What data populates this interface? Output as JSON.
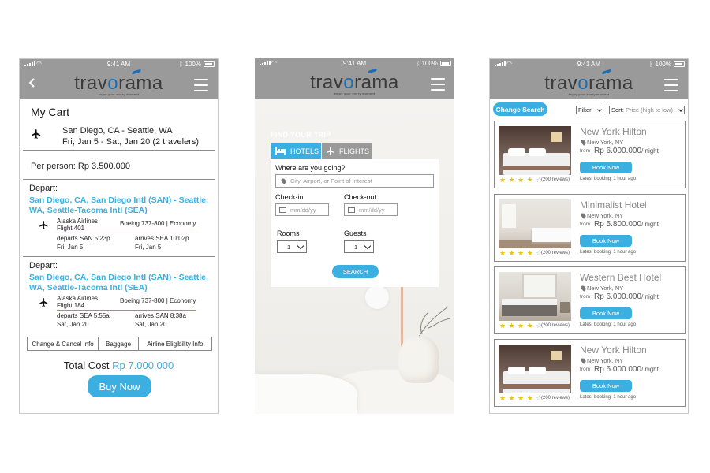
{
  "status": {
    "time": "9:41 AM",
    "battery": "100%"
  },
  "brand": {
    "name_pre": "trav",
    "name_o": "o",
    "name_post": "rama",
    "tagline": "enjoy your every moment"
  },
  "cart": {
    "title": "My Cart",
    "trip_route": "San Diego, CA - Seattle, WA",
    "trip_dates": "Fri, Jan 5 - Sat, Jan 20  (2 travelers)",
    "per_person": "Per person: Rp 3.500.000",
    "flights": [
      {
        "label": "Depart:",
        "route": "San Diego, CA, San Diego Intl (SAN) - Seattle, WA, Seattle-Tacoma Intl (SEA)",
        "airline": "Alaska Airlines",
        "flight": "Flight 401",
        "aircraft": "Boeing 737-800 | Economy",
        "departs": "departs SAN 5:23p",
        "departs_date": "Fri, Jan 5",
        "arrives": "arrives SEA 10:02p",
        "arrives_date": "Fri, Jan 5"
      },
      {
        "label": "Depart:",
        "route": "San Diego, CA, San Diego Intl (SAN) - Seattle, WA, Seattle-Tacoma Intl (SEA)",
        "airline": "Alaska Airlines",
        "flight": "Flight 184",
        "aircraft": "Boeing 737-800 | Economy",
        "departs": "departs SEA 5:55a",
        "departs_date": "Sat, Jan 20",
        "arrives": "arrives SAN 8:38a",
        "arrives_date": "Sat, Jan 20"
      }
    ],
    "tabs": [
      "Change & Cancel Info",
      "Baggage",
      "Airline Eligibility Info"
    ],
    "total_label": "Total Cost",
    "total_amount": "Rp 7.000.000",
    "buy_label": "Buy Now"
  },
  "search": {
    "find_label": "FIND YOUR TRIP",
    "tab_hotels": "HOTELS",
    "tab_flights": "FLIGHTS",
    "where_label": "Where are you going?",
    "where_placeholder": "City, Airport, or Point of Interest",
    "checkin_label": "Check-in",
    "checkout_label": "Check-out",
    "date_placeholder": "mm/dd/yy",
    "rooms_label": "Rooms",
    "rooms_value": "1",
    "guests_label": "Guests",
    "guests_value": "1",
    "search_label": "SEARCH"
  },
  "results": {
    "change_search": "Change Search",
    "filter_label": "Filter:",
    "sort_label": "Sort:",
    "sort_value": "Price (high to low)",
    "hotels": [
      {
        "name": "New York Hilton",
        "location": "New York, NY",
        "from": "from",
        "price": "Rp 6.000.000",
        "per_night": "/ night",
        "book": "Book Now",
        "stars": "★ ★ ★ ★",
        "star_off": "☆",
        "rating": 4,
        "reviews": "(200 reviews)",
        "latest": "Latest booking: 1 hour ago"
      },
      {
        "name": "Minimalist Hotel",
        "location": "New York, NY",
        "from": "from",
        "price": "Rp 5.800.000",
        "per_night": "/ night",
        "book": "Book Now",
        "stars": "★ ★ ★ ★",
        "star_off": "☆",
        "rating": 4,
        "reviews": "(200 reviews)",
        "latest": "Latest booking: 1 hour ago"
      },
      {
        "name": "Western Best Hotel",
        "location": "New York, NY",
        "from": "from",
        "price": "Rp 6.000.000",
        "per_night": "/ night",
        "book": "Book Now",
        "stars": "★ ★ ★ ★",
        "star_off": "☆",
        "rating": 4,
        "reviews": "(200 reviews)",
        "latest": "Latest booking: 1 hour ago"
      },
      {
        "name": "New York Hilton",
        "location": "New York, NY",
        "from": "from",
        "price": "Rp 6.000.000",
        "per_night": "/ night",
        "book": "Book Now",
        "stars": "★ ★ ★ ★",
        "star_off": "☆",
        "rating": 4,
        "reviews": "(200 reviews)",
        "latest": "Latest booking: 1 hour ago"
      }
    ]
  },
  "colors": {
    "accent": "#3bb0e0",
    "appbar": "#9a9a9a",
    "star": "#e9c30b",
    "logo_blue": "#1a6fb5"
  },
  "icons": [
    "signal-icon",
    "wifi-icon",
    "bluetooth-icon",
    "battery-icon",
    "back-icon",
    "menu-icon",
    "plane-icon",
    "bed-icon",
    "pin-icon",
    "calendar-icon",
    "chevron-down-icon",
    "star-icon"
  ]
}
